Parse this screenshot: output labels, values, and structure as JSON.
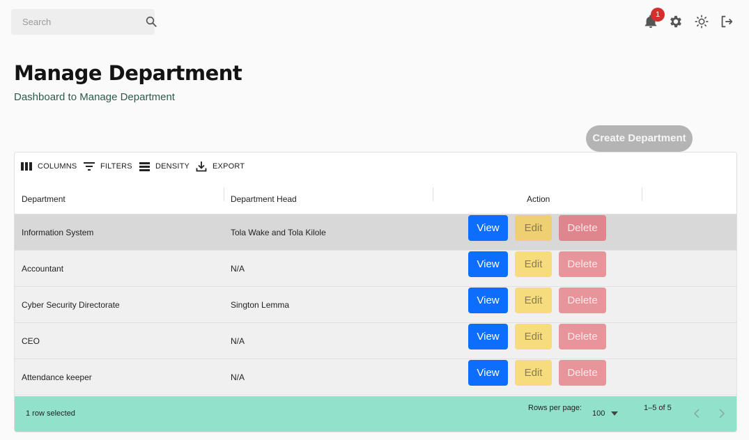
{
  "search": {
    "placeholder": "Search"
  },
  "notifications": {
    "count": "1"
  },
  "page": {
    "title": "Manage Department",
    "subtitle": "Dashboard to Manage Department"
  },
  "actions": {
    "create_label": "Create Department"
  },
  "toolbar": {
    "columns_label": "COLUMNS",
    "filters_label": "FILTERS",
    "density_label": "DENSITY",
    "export_label": "EXPORT"
  },
  "table": {
    "headers": {
      "department": "Department",
      "head": "Department Head",
      "action": "Action"
    },
    "buttons": {
      "view": "View",
      "edit": "Edit",
      "delete": "Delete"
    },
    "rows": [
      {
        "department": "Information System",
        "head": "Tola Wake and Tola Kilole",
        "selected": true
      },
      {
        "department": "Accountant",
        "head": "N/A",
        "selected": false
      },
      {
        "department": "Cyber Security Directorate",
        "head": "Sington Lemma",
        "selected": false
      },
      {
        "department": "CEO",
        "head": "N/A",
        "selected": false
      },
      {
        "department": "Attendance keeper",
        "head": "N/A",
        "selected": false
      }
    ]
  },
  "footer": {
    "selected_text": "1 row selected",
    "rows_per_page_label": "Rows per page:",
    "rows_per_page_value": "100",
    "range_text": "1–5 of 5"
  },
  "colors": {
    "primary": "#0d6efd",
    "warning": "#f7dc7d",
    "danger": "#e8949b",
    "footer_bg": "#92e2cb",
    "badge": "#d32f2f"
  }
}
